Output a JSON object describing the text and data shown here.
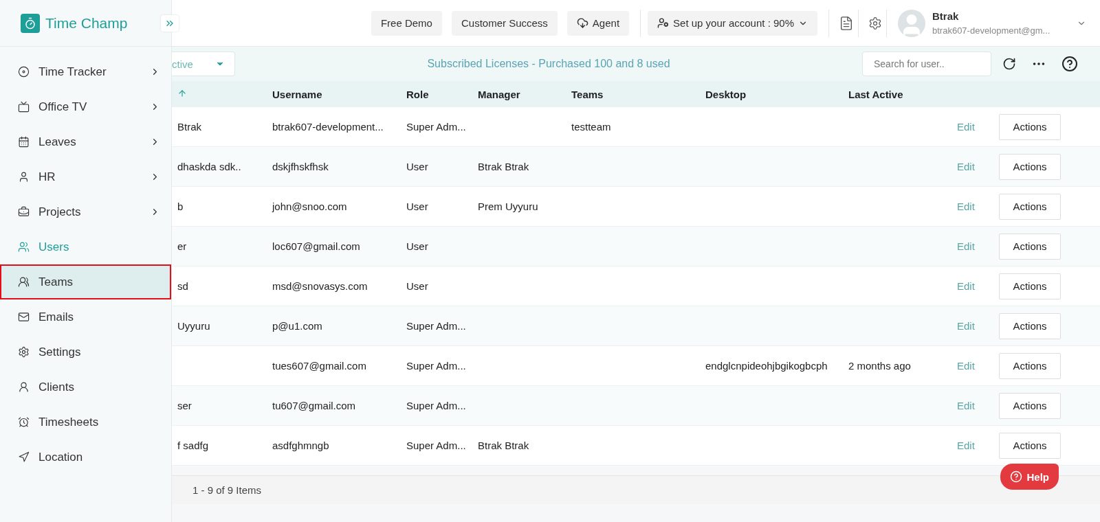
{
  "brand": {
    "name": "Time Champ"
  },
  "sidebar": {
    "items": [
      {
        "label": "Time Tracker",
        "submenu": true,
        "current": false,
        "selected": false
      },
      {
        "label": "Office TV",
        "submenu": true,
        "current": false,
        "selected": false
      },
      {
        "label": "Leaves",
        "submenu": true,
        "current": false,
        "selected": false
      },
      {
        "label": "HR",
        "submenu": true,
        "current": false,
        "selected": false
      },
      {
        "label": "Projects",
        "submenu": true,
        "current": false,
        "selected": false
      },
      {
        "label": "Users",
        "submenu": false,
        "current": true,
        "selected": false
      },
      {
        "label": "Teams",
        "submenu": false,
        "current": false,
        "selected": true
      },
      {
        "label": "Emails",
        "submenu": false,
        "current": false,
        "selected": false
      },
      {
        "label": "Settings",
        "submenu": false,
        "current": false,
        "selected": false
      },
      {
        "label": "Clients",
        "submenu": false,
        "current": false,
        "selected": false
      },
      {
        "label": "Timesheets",
        "submenu": false,
        "current": false,
        "selected": false
      },
      {
        "label": "Location",
        "submenu": false,
        "current": false,
        "selected": false
      }
    ]
  },
  "header": {
    "buttons": [
      {
        "label": "Free Demo",
        "kind": "plain"
      },
      {
        "label": "Customer Success",
        "kind": "plain"
      },
      {
        "label": "Agent",
        "kind": "download"
      }
    ],
    "setup": {
      "label": "Set up your account : 90%"
    },
    "profile": {
      "name": "Btrak",
      "email": "btrak607-development@gm..."
    }
  },
  "toolbar": {
    "filter": "ctive",
    "licenses": "Subscribed Licenses - Purchased 100 and 8 used",
    "search": {
      "placeholder": "Search for user.."
    }
  },
  "table": {
    "columns": [
      "Username",
      "Role",
      "Manager",
      "Teams",
      "Desktop",
      "Last Active"
    ],
    "rows": [
      {
        "name": "Btrak",
        "username": "btrak607-development...",
        "role": "Super Adm...",
        "teams": "testteam",
        "edit": "Edit",
        "action": "Actions"
      },
      {
        "name": "dhaskda sdk..",
        "username": "dskjfhskfhsk",
        "role": "User",
        "manager": "Btrak Btrak",
        "edit": "Edit",
        "action": "Actions"
      },
      {
        "name": "b",
        "username": "john@snoo.com",
        "role": "User",
        "manager": "Prem Uyyuru",
        "edit": "Edit",
        "action": "Actions"
      },
      {
        "name": "er",
        "username": "loc607@gmail.com",
        "role": "User",
        "edit": "Edit",
        "action": "Actions"
      },
      {
        "name": "sd",
        "username": "msd@snovasys.com",
        "role": "User",
        "edit": "Edit",
        "action": "Actions"
      },
      {
        "name": "Uyyuru",
        "username": "p@u1.com",
        "role": "Super Adm...",
        "edit": "Edit",
        "action": "Actions"
      },
      {
        "username": "tues607@gmail.com",
        "role": "Super Adm...",
        "desktop": "endglcnpideohjbgikogbcph",
        "last_active": "2 months ago",
        "edit": "Edit",
        "action": "Actions"
      },
      {
        "name": "ser",
        "username": "tu607@gmail.com",
        "role": "Super Adm...",
        "edit": "Edit",
        "action": "Actions"
      },
      {
        "name": "f sadfg",
        "username": "asdfghmngb",
        "role": "Super Adm...",
        "manager": "Btrak Btrak",
        "edit": "Edit",
        "action": "Actions"
      }
    ]
  },
  "pager": {
    "summary": "1 - 9 of 9 Items"
  },
  "help": {
    "label": "Help"
  }
}
